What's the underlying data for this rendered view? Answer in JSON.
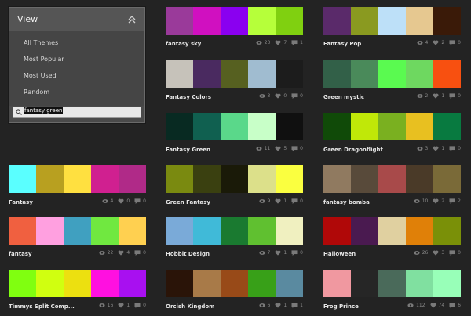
{
  "view_panel": {
    "title": "View",
    "items": [
      "All Themes",
      "Most Popular",
      "Most Used",
      "Random"
    ],
    "search_value": "fantasy green"
  },
  "themes": [
    {
      "name": "fantasy sky",
      "views": "23",
      "likes": "7",
      "comments": "1",
      "colors": [
        "#9a3a9a",
        "#d010c0",
        "#8a00f0",
        "#b6ff3a",
        "#80d010"
      ]
    },
    {
      "name": "Fantasy Pop",
      "views": "4",
      "likes": "2",
      "comments": "0",
      "colors": [
        "#5a2a6a",
        "#8a9a20",
        "#bde0f8",
        "#e6c890",
        "#3a1a08"
      ]
    },
    {
      "name": "Fantasy Colors",
      "views": "3",
      "likes": "0",
      "comments": "0",
      "colors": [
        "#c6c2ba",
        "#4a2a60",
        "#566020",
        "#a0bcd0",
        "#1c1c1c"
      ]
    },
    {
      "name": "Green mystic",
      "views": "2",
      "likes": "1",
      "comments": "0",
      "colors": [
        "#326048",
        "#4a8a5a",
        "#5afa50",
        "#6ed860",
        "#f85010"
      ]
    },
    {
      "name": "Fantasy Green",
      "views": "11",
      "likes": "5",
      "comments": "0",
      "colors": [
        "#082a22",
        "#106050",
        "#5ad88a",
        "#c8ffc8",
        "#101010"
      ]
    },
    {
      "name": "Green Dragonflight",
      "views": "3",
      "likes": "1",
      "comments": "0",
      "colors": [
        "#104a08",
        "#c0e808",
        "#7ab020",
        "#e8c020",
        "#087a40"
      ]
    },
    {
      "name": "Fantasy",
      "views": "4",
      "likes": "0",
      "comments": "0",
      "colors": [
        "#5affff",
        "#b8a020",
        "#ffe040",
        "#d02090",
        "#b02a88"
      ]
    },
    {
      "name": "Green Fantasy",
      "views": "9",
      "likes": "1",
      "comments": "0",
      "colors": [
        "#7a8a10",
        "#3a4010",
        "#1a1a08",
        "#dce08a",
        "#faff40"
      ]
    },
    {
      "name": "fantasy bomba",
      "views": "10",
      "likes": "2",
      "comments": "2",
      "colors": [
        "#907a60",
        "#584a3a",
        "#a84a4a",
        "#4a3a28",
        "#7a6a38"
      ]
    },
    {
      "name": "fantasy",
      "views": "22",
      "likes": "4",
      "comments": "0",
      "colors": [
        "#f06040",
        "#ffa0e0",
        "#40a0c0",
        "#70e840",
        "#ffd050"
      ]
    },
    {
      "name": "Hobbit Design",
      "views": "7",
      "likes": "1",
      "comments": "0",
      "colors": [
        "#7aaad8",
        "#40bad8",
        "#1a7a30",
        "#60c030",
        "#f0f0c0"
      ]
    },
    {
      "name": "Halloween",
      "views": "26",
      "likes": "3",
      "comments": "0",
      "colors": [
        "#b00808",
        "#4a1a50",
        "#e0d0a0",
        "#e08008",
        "#7a9008"
      ]
    },
    {
      "name": "Timmys Split Comp...",
      "views": "16",
      "likes": "1",
      "comments": "0",
      "colors": [
        "#80ff10",
        "#d0ff10",
        "#ece010",
        "#ff10e0",
        "#a810f0"
      ]
    },
    {
      "name": "Orcish Kingdom",
      "views": "6",
      "likes": "1",
      "comments": "1",
      "colors": [
        "#2a1408",
        "#a87a48",
        "#984a18",
        "#38a018",
        "#5a8aa0"
      ]
    },
    {
      "name": "Frog Prince",
      "views": "112",
      "likes": "74",
      "comments": "6",
      "colors": [
        "#f098a0",
        "#262626",
        "#4a6a5a",
        "#80e0a0",
        "#98ffb8"
      ]
    }
  ],
  "icons": {
    "views": "eye-icon",
    "likes": "heart-icon",
    "comments": "comment-icon",
    "search": "search-icon",
    "collapse": "chevron-up-double-icon"
  }
}
